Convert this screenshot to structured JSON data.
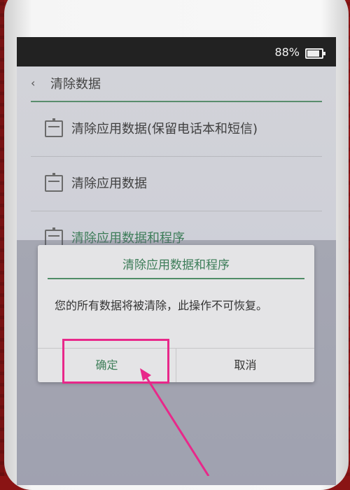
{
  "status_bar": {
    "battery_percent": "88%"
  },
  "nav": {
    "back_symbol": "‹",
    "title": "清除数据"
  },
  "menu": {
    "items": [
      {
        "label": "清除应用数据(保留电话本和短信)"
      },
      {
        "label": "清除应用数据"
      },
      {
        "label": "清除应用数据和程序"
      }
    ]
  },
  "dialog": {
    "title": "清除应用数据和程序",
    "message": "您的所有数据将被清除，此操作不可恢复。",
    "confirm_label": "确定",
    "cancel_label": "取消"
  },
  "colors": {
    "accent": "#3f7f5a",
    "annotation": "#e8288a"
  }
}
